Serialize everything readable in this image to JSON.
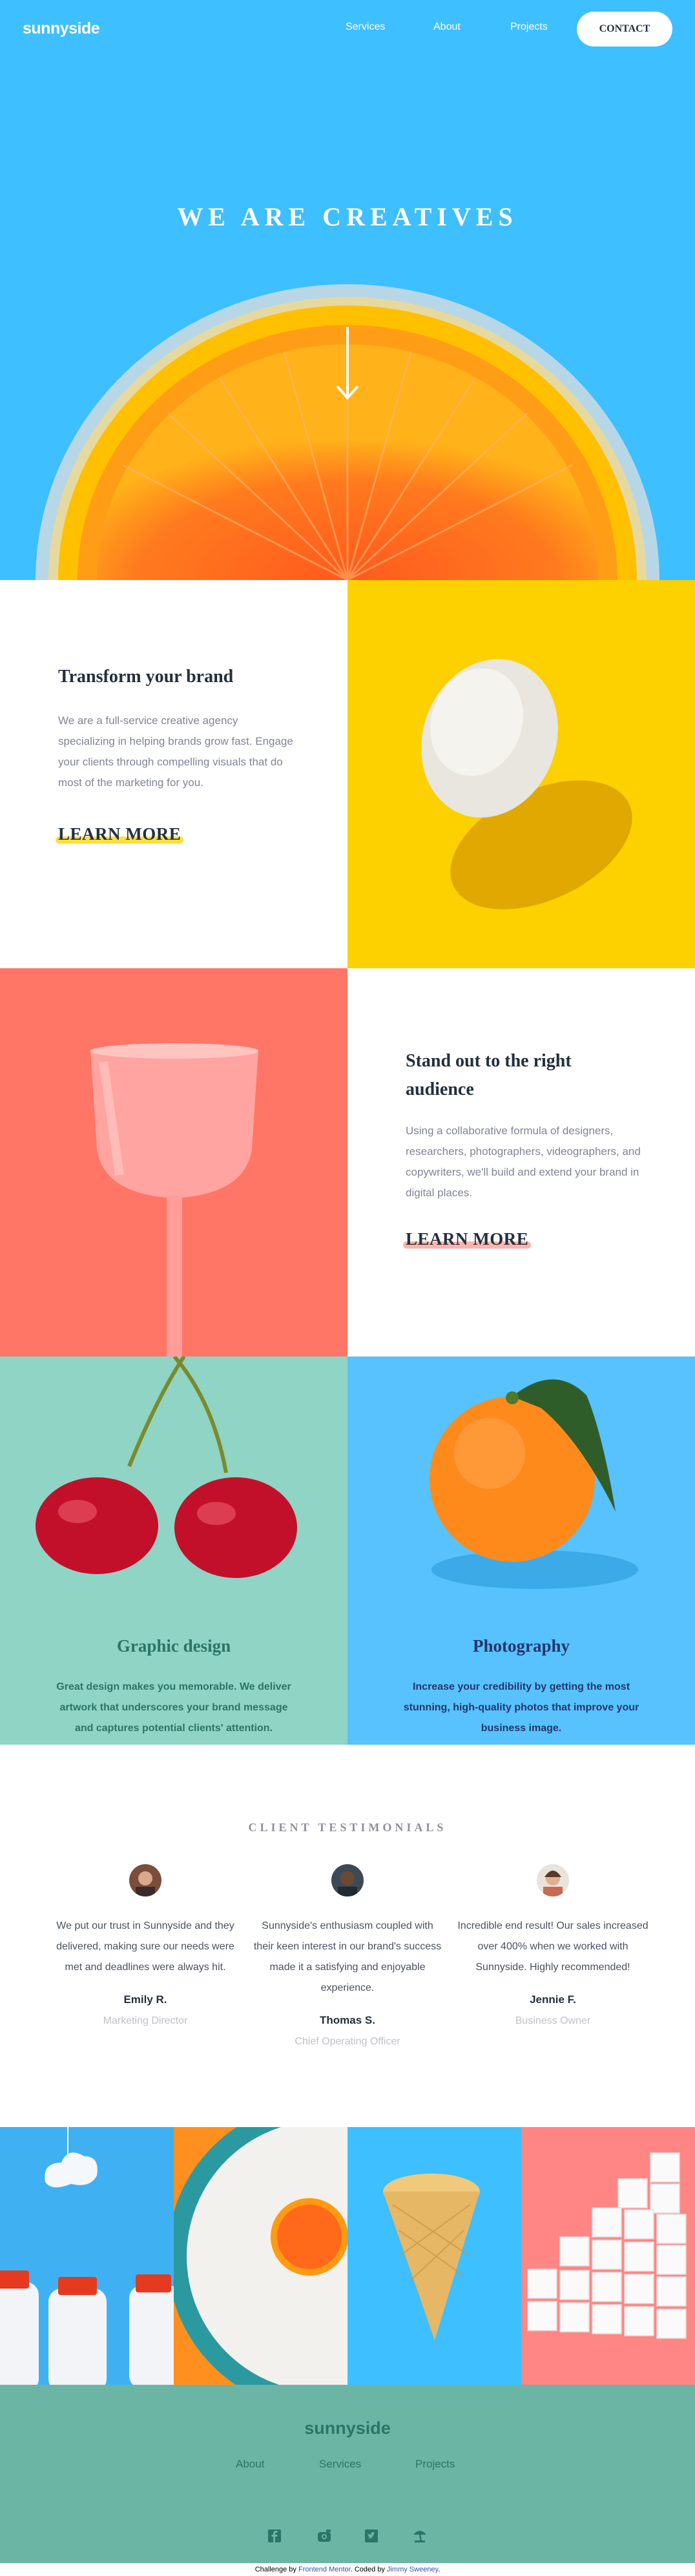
{
  "nav": {
    "logo": "sunnyside",
    "links": [
      "Services",
      "About",
      "Projects"
    ],
    "contact": "CONTACT"
  },
  "hero": {
    "title": "WE ARE CREATIVES",
    "arrow_icon": "arrow-down-icon"
  },
  "features": [
    {
      "title": "Transform your brand",
      "body": "We are a full-service creative agency specializing in helping brands grow fast. Engage your clients through compelling visuals that do most of the marketing for you.",
      "cta": "LEARN MORE",
      "underline_color": "#fad400"
    },
    {
      "title": "Stand out to the right audience",
      "body": "Using a collaborative formula of designers, researchers, photographers, videographers, and copywriters, we'll build and extend your brand in digital places.",
      "cta": "LEARN MORE",
      "underline_color": "#fe7766"
    }
  ],
  "services": [
    {
      "title": "Graphic design",
      "body": "Great design makes you memorable. We deliver artwork that underscores your brand message and captures potential clients' attention.",
      "color": "#2c7566",
      "background": "#90d4c5"
    },
    {
      "title": "Photography",
      "body": "Increase your credibility by getting the most stunning, high-quality photos that improve your business image.",
      "color": "#24366b",
      "background": "#57c2fe"
    }
  ],
  "testimonials": {
    "heading": "CLIENT TESTIMONIALS",
    "items": [
      {
        "quote": "We put our trust in Sunnyside and they delivered, making sure our needs were met and deadlines were always hit.",
        "name": "Emily R.",
        "role": "Marketing Director"
      },
      {
        "quote": "Sunnyside's enthusiasm coupled with their keen interest in our brand's success made it a satisfying and enjoyable experience.",
        "name": "Thomas S.",
        "role": "Chief Operating Officer"
      },
      {
        "quote": "Incredible end result! Our sales increased over 400% when we worked with Sunnyside. Highly recommended!",
        "name": "Jennie F.",
        "role": "Business Owner"
      }
    ]
  },
  "footer": {
    "logo": "sunnyside",
    "links": [
      "About",
      "Services",
      "Projects"
    ],
    "social_icons": [
      "facebook-icon",
      "instagram-icon",
      "twitter-icon",
      "pinterest-icon"
    ]
  },
  "attribution": {
    "prefix": "Challenge by",
    "fm": "Frontend Mentor",
    "mid": ". Coded by",
    "author": "Jimmy Sweeney",
    "suffix": "."
  },
  "colors": {
    "hero_bg": "#3ebfff",
    "yellow": "#fad400",
    "salmon": "#fe7766",
    "footer_bg": "#6ab5a4"
  }
}
